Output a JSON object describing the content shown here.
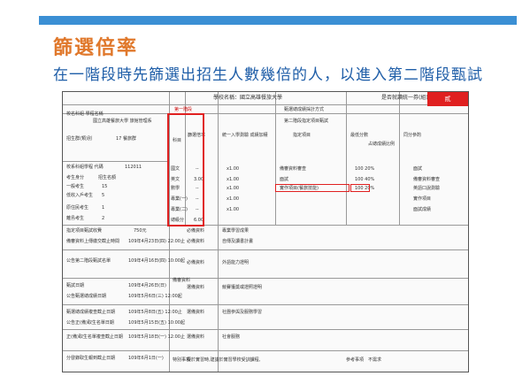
{
  "slide": {
    "title": "篩選倍率",
    "subtitle": "在一階段時先篩選出招生人數幾倍的人，以進入第二階段甄試",
    "accent_color": "#e0782b",
    "subtitle_color": "#1f5ea8",
    "bar_color": "#3b8fd4"
  },
  "doc": {
    "school_header": "學校名稱：國立高雄餐旅大學",
    "unit_header": "是否就讀統一券(組)",
    "badge": "貳",
    "section_title": "甄選總成績採計方式",
    "stage_label": "第一階段",
    "second_stage": "第二階段指定項目甄試",
    "left_labels": [
      {
        "label": "校名科組 學程名稱",
        "value": "國立高雄餐旅大學 旅館管理系"
      },
      {
        "label": "招生群(類)別",
        "value": "17 餐旅群"
      },
      {
        "label": "校系科組學程 代碼",
        "value": "112011"
      },
      {
        "label": "考生身分",
        "value": "招生名額"
      },
      {
        "label": "一般考生",
        "value": "15"
      },
      {
        "label": "低收入戶考生",
        "value": "5"
      },
      {
        "label": "原住民考生",
        "value": "1"
      },
      {
        "label": "離島考生",
        "value": "2"
      }
    ],
    "col_headers": [
      "科目",
      "篩選倍率",
      "統一入學測驗 成績加權",
      "指定項目",
      "最低分數",
      "占總成績比例",
      "同分參酌"
    ],
    "rows": [
      {
        "subject": "國文",
        "ratio": "--",
        "weight": "x1.00",
        "item": "備審資料審查",
        "pct": "100 20%"
      },
      {
        "subject": "英文",
        "ratio": "3.00",
        "weight": "x1.00",
        "item": "面試",
        "pct": "100 40%"
      },
      {
        "subject": "數學",
        "ratio": "--",
        "weight": "x1.00",
        "item": "實作項目(餐旅技能)",
        "pct": "100 20%"
      },
      {
        "subject": "專業(一)",
        "ratio": "--",
        "weight": "x1.00",
        "item": "",
        "pct": ""
      },
      {
        "subject": "專業(二)",
        "ratio": "--",
        "weight": "x1.00",
        "item": "",
        "pct": ""
      },
      {
        "subject": "總級分",
        "ratio": "6.00",
        "weight": "",
        "item": "",
        "pct": ""
      }
    ],
    "right_notes": [
      "面試",
      "備審資料審查",
      "英語口說測驗",
      "實作項目",
      "面試成績"
    ],
    "lower_rows": [
      {
        "label": "指定項目甄試收費",
        "value": "750元"
      },
      {
        "label": "備審資料上傳繳交截止時間",
        "value": "109年4月23日(四) 22:00止"
      },
      {
        "label": "公告第二階段甄試名單",
        "value": "109年4月16日(四) 10:00起"
      },
      {
        "label": "甄試日期",
        "value": "109年4月26日(日)"
      },
      {
        "label": "公告甄選總成績日期",
        "value": "109年5月6日(三) 12:00起"
      },
      {
        "label": "甄選總成績複查截止日期",
        "value": "109年5月8日(五) 12:00止"
      },
      {
        "label": "公告正(備)取生名單日期",
        "value": "109年5月15日(五) 10:00起"
      },
      {
        "label": "正(備)取生名單複查截止日期",
        "value": "109年5月18日(一) 12:00止"
      },
      {
        "label": "分發錄取生報到截止日期",
        "value": "109年6月1日(一)"
      }
    ],
    "review_items": [
      "專業學習成果",
      "自傳及讀書計畫",
      "外語能力證明",
      "競賽獲獎或證照證明",
      "社團參與及服務學習",
      "社會服務"
    ],
    "review_group_label": "備審資料",
    "review_tags": [
      "必備資料",
      "必備資料",
      "必備資料",
      "選備資料",
      "選備資料",
      "選備資料"
    ],
    "special_label": "特別事項",
    "special_text": "擬於實習時,建議於實習學校受訓課程,",
    "special_note_label": "參考事項",
    "special_note": "不需求"
  }
}
